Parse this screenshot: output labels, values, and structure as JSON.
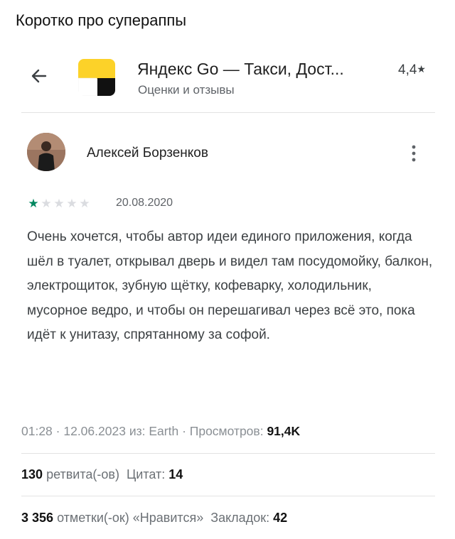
{
  "caption": "Коротко про супераппы",
  "app": {
    "title": "Яндекс Go — Такси, Дост...",
    "subtitle": "Оценки и отзывы",
    "rating": "4,4",
    "back_icon": "arrow-back-icon",
    "icon_colors": {
      "top": "#fcd229",
      "bottom_left": "#ffffff",
      "bottom_right": "#111111"
    }
  },
  "review": {
    "author": "Алексей Борзенков",
    "stars_filled": 1,
    "stars_total": 5,
    "star_color": "#01875f",
    "date": "20.08.2020",
    "text": "Очень хочется, чтобы автор идеи единого приложения, когда шёл в туалет, открывал дверь и видел там посудомойку, балкон, электрощиток, зубную щётку, кофеварку, холодильник, мусорное ведро, и чтобы он перешагивал через всё это, пока идёт к унитазу, спрятанному за софой.",
    "more_icon": "more-vertical-icon"
  },
  "tweet": {
    "time": "01:28",
    "date": "12.06.2023",
    "from_label": "из:",
    "source": "Earth",
    "views_label": "Просмотров:",
    "views": "91,4K",
    "retweets": "130",
    "retweets_label": "ретвита(-ов)",
    "quotes_label": "Цитат:",
    "quotes": "14",
    "likes": "3 356",
    "likes_label": "отметки(-ок) «Нравится»",
    "bookmarks_label": "Закладок:",
    "bookmarks": "42"
  }
}
